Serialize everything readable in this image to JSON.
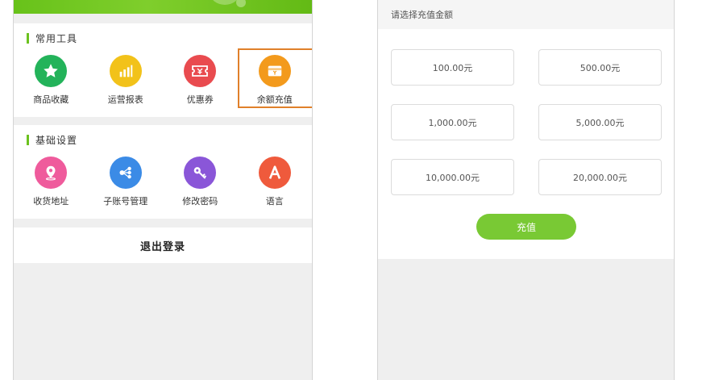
{
  "tools": {
    "title": "常用工具",
    "items": [
      {
        "label": "商品收藏",
        "icon": "star-icon"
      },
      {
        "label": "运营报表",
        "icon": "bar-chart-icon"
      },
      {
        "label": "优惠券",
        "icon": "coupon-icon"
      },
      {
        "label": "余额充值",
        "icon": "wallet-icon"
      }
    ]
  },
  "settings": {
    "title": "基础设置",
    "items": [
      {
        "label": "收货地址",
        "icon": "location-pin-icon"
      },
      {
        "label": "子账号管理",
        "icon": "share-nodes-icon"
      },
      {
        "label": "修改密码",
        "icon": "key-icon"
      },
      {
        "label": "语言",
        "icon": "letter-a-icon"
      }
    ]
  },
  "logout_label": "退出登录",
  "recharge": {
    "prompt": "请选择充值金额",
    "amounts": [
      "100.00元",
      "500.00元",
      "1,000.00元",
      "5,000.00元",
      "10,000.00元",
      "20,000.00元"
    ],
    "button_label": "充值"
  },
  "colors": {
    "brand_green": "#6cc21f",
    "highlight_border": "#e0802a"
  }
}
